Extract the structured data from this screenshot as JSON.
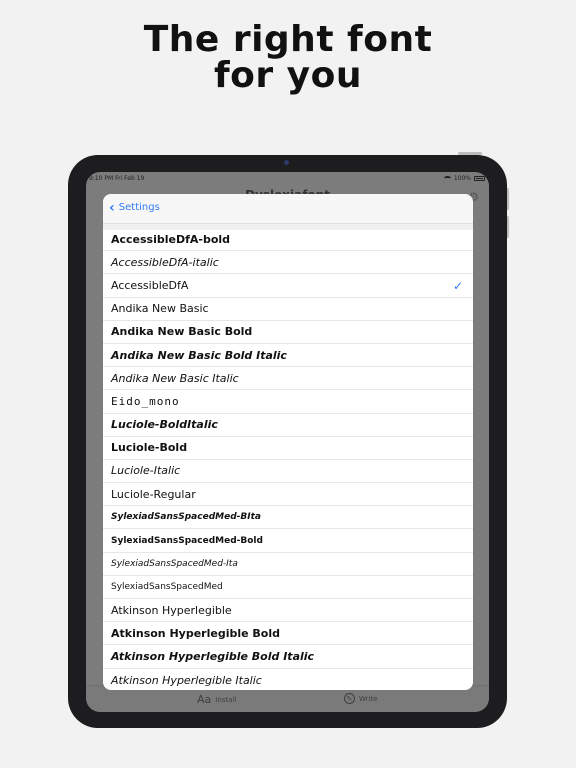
{
  "headline": {
    "line1": "The right font",
    "line2": "for you"
  },
  "status_bar": {
    "time": "9:10 PM  Fri Feb 19",
    "battery": "100%"
  },
  "background": {
    "title": "Dyslexiafont"
  },
  "modal": {
    "back_label": "Settings",
    "fonts": [
      {
        "label": "AccessibleDfA-bold",
        "style": "bold",
        "checked": false
      },
      {
        "label": "AccessibleDfA-italic",
        "style": "italic",
        "checked": false
      },
      {
        "label": "AccessibleDfA",
        "style": "regular",
        "checked": true
      },
      {
        "label": "Andika New Basic",
        "style": "regular",
        "checked": false
      },
      {
        "label": "Andika New Basic Bold",
        "style": "bold",
        "checked": false
      },
      {
        "label": "Andika New Basic Bold Italic",
        "style": "bolditalic",
        "checked": false
      },
      {
        "label": "Andika New Basic Italic",
        "style": "italic",
        "checked": false
      },
      {
        "label": "Eido_mono",
        "style": "mono",
        "checked": false
      },
      {
        "label": "Luciole-BoldItalic",
        "style": "bolditalic",
        "checked": false
      },
      {
        "label": "Luciole-Bold",
        "style": "bold",
        "checked": false
      },
      {
        "label": "Luciole-Italic",
        "style": "italic",
        "checked": false
      },
      {
        "label": "Luciole-Regular",
        "style": "regular",
        "checked": false
      },
      {
        "label": "SylexiadSansSpacedMed-BIta",
        "style": "bolditalic-small",
        "checked": false
      },
      {
        "label": "SylexiadSansSpacedMed-Bold",
        "style": "bold-small",
        "checked": false
      },
      {
        "label": "SylexiadSansSpacedMed-Ita",
        "style": "italic-small",
        "checked": false
      },
      {
        "label": "SylexiadSansSpacedMed",
        "style": "regular-small",
        "checked": false
      },
      {
        "label": "Atkinson Hyperlegible",
        "style": "regular",
        "checked": false
      },
      {
        "label": "Atkinson Hyperlegible Bold",
        "style": "bold",
        "checked": false
      },
      {
        "label": "Atkinson Hyperlegible Bold Italic",
        "style": "bolditalic",
        "checked": false
      },
      {
        "label": "Atkinson Hyperlegible Italic",
        "style": "italic",
        "checked": false
      }
    ]
  },
  "tabbar": {
    "install_icon_text": "Aa",
    "install_label": "Install",
    "write_label": "Write"
  },
  "icons": {
    "back": "chevron-left-icon",
    "check": "checkmark-icon",
    "install": "font-aa-icon",
    "write": "pen-circle-icon",
    "gear": "gear-icon",
    "wifi": "wifi-icon",
    "battery": "battery-icon"
  },
  "colors": {
    "accent": "#2f7cf6",
    "page_bg": "#f2f2f2",
    "device": "#1d1d1f"
  }
}
